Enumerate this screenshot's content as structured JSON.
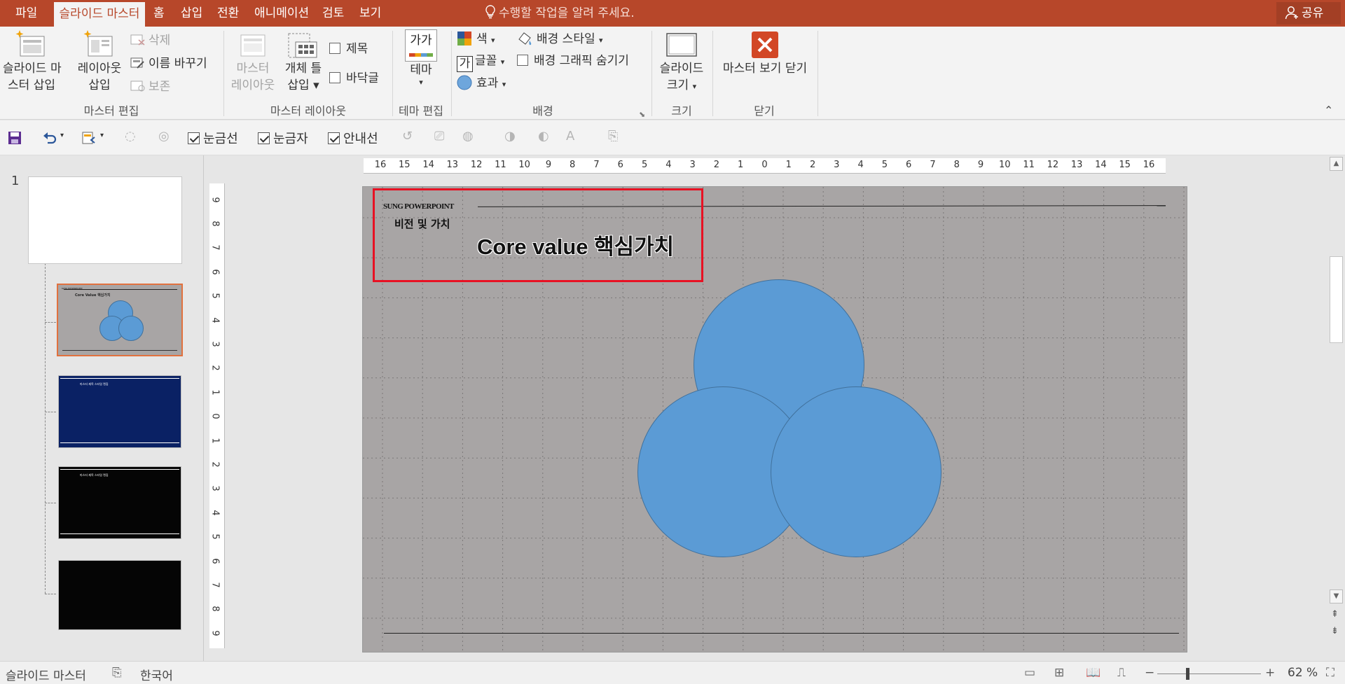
{
  "tabs": [
    {
      "label": "파일",
      "active": false
    },
    {
      "label": "슬라이드 마스터",
      "active": true
    },
    {
      "label": "홈",
      "active": false
    },
    {
      "label": "삽입",
      "active": false
    },
    {
      "label": "전환",
      "active": false
    },
    {
      "label": "애니메이션",
      "active": false
    },
    {
      "label": "검토",
      "active": false
    },
    {
      "label": "보기",
      "active": false
    }
  ],
  "tell_me": "수행할 작업을 알려 주세요.",
  "share": "공유",
  "ribbon": {
    "edit_master": {
      "insert_master_1": "슬라이드 마",
      "insert_master_2": "스터 삽입",
      "insert_layout_1": "레이아웃",
      "insert_layout_2": "삽입",
      "delete": "삭제",
      "rename": "이름 바꾸기",
      "preserve": "보존",
      "label": "마스터 편집"
    },
    "master_layout": {
      "master_layout_1": "마스터",
      "master_layout_2": "레이아웃",
      "insert_placeholder_1": "개체 틀",
      "insert_placeholder_2": "삽입",
      "title_cb": "제목",
      "footer_cb": "바닥글",
      "label": "마스터 레이아웃"
    },
    "edit_theme": {
      "theme_icon_text": "가가",
      "themes": "테마",
      "label": "테마 편집"
    },
    "background": {
      "colors": "색",
      "fonts": "글꼴",
      "font_icon_text": "가",
      "effects": "효과",
      "bg_styles": "배경 스타일",
      "hide_bg": "배경 그래픽 숨기기",
      "label": "배경"
    },
    "size": {
      "slide_size_1": "슬라이드",
      "slide_size_2": "크기",
      "label": "크기"
    },
    "close": {
      "close_master": "마스터 보기 닫기",
      "label": "닫기"
    }
  },
  "qat": {
    "gridlines": "눈금선",
    "ruler": "눈금자",
    "guides": "안내선"
  },
  "thumbnails": {
    "slide_number": "1",
    "master_title": "SUNG POWERPOINT",
    "master_sub": "Core Value 핵심가치",
    "dark_text": "마스터 제목 스타일 편집"
  },
  "ruler": {
    "h_ticks": [
      "16",
      "15",
      "14",
      "13",
      "12",
      "11",
      "10",
      "9",
      "8",
      "7",
      "6",
      "5",
      "4",
      "3",
      "2",
      "1",
      "0",
      "1",
      "2",
      "3",
      "4",
      "5",
      "6",
      "7",
      "8",
      "9",
      "10",
      "11",
      "12",
      "13",
      "14",
      "15",
      "16"
    ],
    "v_ticks": [
      "9",
      "8",
      "7",
      "6",
      "5",
      "4",
      "3",
      "2",
      "1",
      "0",
      "1",
      "2",
      "3",
      "4",
      "5",
      "6",
      "7",
      "8",
      "9"
    ]
  },
  "slide": {
    "brand": "SUNG POWERPOINT",
    "subtitle": "비전 및 가치",
    "title": "Core value 핵심가치",
    "bg": "#a8a5a5",
    "circle_color": "#5b9bd5",
    "highlight_color": "#e81123"
  },
  "status": {
    "view": "슬라이드 마스터",
    "language": "한국어",
    "zoom": "62 %",
    "zoom_level_percent": 62
  },
  "colors": {
    "accent": "#b7472a"
  }
}
